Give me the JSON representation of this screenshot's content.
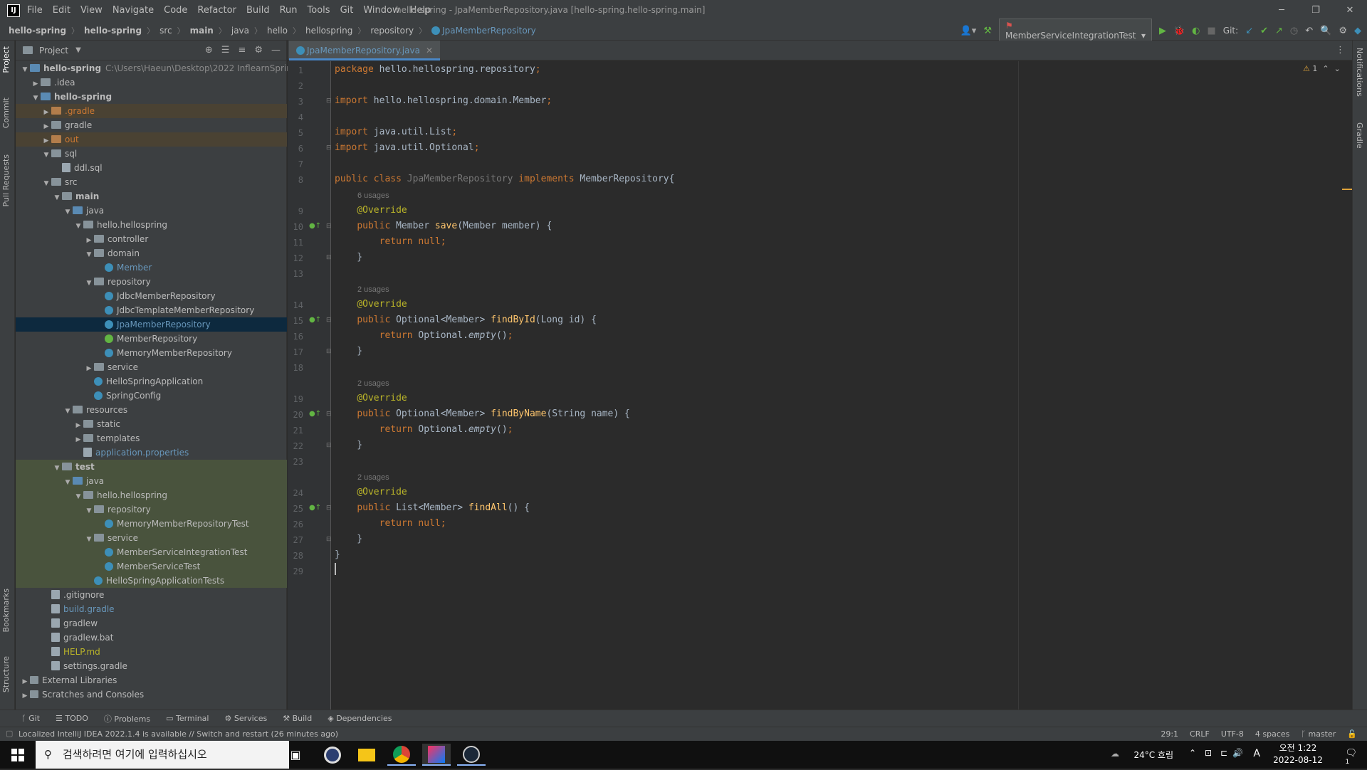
{
  "window": {
    "title": "hello-spring - JpaMemberRepository.java [hello-spring.hello-spring.main]",
    "menu": [
      "File",
      "Edit",
      "View",
      "Navigate",
      "Code",
      "Refactor",
      "Build",
      "Run",
      "Tools",
      "Git",
      "Window",
      "Help"
    ]
  },
  "breadcrumb": [
    "hello-spring",
    "hello-spring",
    "src",
    "main",
    "java",
    "hello",
    "hellospring",
    "repository",
    "JpaMemberRepository"
  ],
  "toolbar": {
    "run_config": "MemberServiceIntegrationTest",
    "git_label": "Git:"
  },
  "project": {
    "title": "Project",
    "tree": [
      {
        "label": "hello-spring",
        "extra": "C:\\Users\\Haeun\\Desktop\\2022 InflearnSpring",
        "depth": 0,
        "kind": "folder-blue",
        "arrow": "open",
        "bold": true
      },
      {
        "label": ".idea",
        "depth": 1,
        "kind": "folder",
        "arrow": "closed"
      },
      {
        "label": "hello-spring",
        "depth": 1,
        "kind": "folder-blue",
        "arrow": "open",
        "bold": true
      },
      {
        "label": ".gradle",
        "depth": 2,
        "kind": "folder-orange",
        "arrow": "closed",
        "color": "orange",
        "hl": "orange"
      },
      {
        "label": "gradle",
        "depth": 2,
        "kind": "folder",
        "arrow": "closed"
      },
      {
        "label": "out",
        "depth": 2,
        "kind": "folder-orange",
        "arrow": "closed",
        "color": "orange",
        "hl": "orange"
      },
      {
        "label": "sql",
        "depth": 2,
        "kind": "folder",
        "arrow": "open"
      },
      {
        "label": "ddl.sql",
        "depth": 3,
        "kind": "file"
      },
      {
        "label": "src",
        "depth": 2,
        "kind": "folder",
        "arrow": "open"
      },
      {
        "label": "main",
        "depth": 3,
        "kind": "folder",
        "arrow": "open",
        "bold": true
      },
      {
        "label": "java",
        "depth": 4,
        "kind": "folder-blue",
        "arrow": "open"
      },
      {
        "label": "hello.hellospring",
        "depth": 5,
        "kind": "folder",
        "arrow": "open"
      },
      {
        "label": "controller",
        "depth": 6,
        "kind": "folder",
        "arrow": "closed"
      },
      {
        "label": "domain",
        "depth": 6,
        "kind": "folder",
        "arrow": "open"
      },
      {
        "label": "Member",
        "depth": 7,
        "kind": "class",
        "color": "blue"
      },
      {
        "label": "repository",
        "depth": 6,
        "kind": "folder",
        "arrow": "open"
      },
      {
        "label": "JdbcMemberRepository",
        "depth": 7,
        "kind": "class"
      },
      {
        "label": "JdbcTemplateMemberRepository",
        "depth": 7,
        "kind": "class"
      },
      {
        "label": "JpaMemberRepository",
        "depth": 7,
        "kind": "class",
        "color": "blue",
        "hl": "sel"
      },
      {
        "label": "MemberRepository",
        "depth": 7,
        "kind": "interface"
      },
      {
        "label": "MemoryMemberRepository",
        "depth": 7,
        "kind": "class"
      },
      {
        "label": "service",
        "depth": 6,
        "kind": "folder",
        "arrow": "closed"
      },
      {
        "label": "HelloSpringApplication",
        "depth": 6,
        "kind": "class"
      },
      {
        "label": "SpringConfig",
        "depth": 6,
        "kind": "class"
      },
      {
        "label": "resources",
        "depth": 4,
        "kind": "folder",
        "arrow": "open"
      },
      {
        "label": "static",
        "depth": 5,
        "kind": "folder",
        "arrow": "closed"
      },
      {
        "label": "templates",
        "depth": 5,
        "kind": "folder",
        "arrow": "closed"
      },
      {
        "label": "application.properties",
        "depth": 5,
        "kind": "file",
        "color": "blue"
      },
      {
        "label": "test",
        "depth": 3,
        "kind": "folder",
        "arrow": "open",
        "bold": true,
        "hl": "green"
      },
      {
        "label": "java",
        "depth": 4,
        "kind": "folder-blue",
        "arrow": "open",
        "hl": "green"
      },
      {
        "label": "hello.hellospring",
        "depth": 5,
        "kind": "folder",
        "arrow": "open",
        "hl": "green"
      },
      {
        "label": "repository",
        "depth": 6,
        "kind": "folder",
        "arrow": "open",
        "hl": "green"
      },
      {
        "label": "MemoryMemberRepositoryTest",
        "depth": 7,
        "kind": "class",
        "hl": "green"
      },
      {
        "label": "service",
        "depth": 6,
        "kind": "folder",
        "arrow": "open",
        "hl": "green"
      },
      {
        "label": "MemberServiceIntegrationTest",
        "depth": 7,
        "kind": "class",
        "hl": "green"
      },
      {
        "label": "MemberServiceTest",
        "depth": 7,
        "kind": "class",
        "hl": "green"
      },
      {
        "label": "HelloSpringApplicationTests",
        "depth": 6,
        "kind": "class",
        "hl": "green"
      },
      {
        "label": ".gitignore",
        "depth": 2,
        "kind": "file"
      },
      {
        "label": "build.gradle",
        "depth": 2,
        "kind": "file",
        "color": "blue"
      },
      {
        "label": "gradlew",
        "depth": 2,
        "kind": "file"
      },
      {
        "label": "gradlew.bat",
        "depth": 2,
        "kind": "file"
      },
      {
        "label": "HELP.md",
        "depth": 2,
        "kind": "file",
        "color": "gold"
      },
      {
        "label": "settings.gradle",
        "depth": 2,
        "kind": "file"
      },
      {
        "label": "External Libraries",
        "depth": 0,
        "kind": "lib",
        "arrow": "closed"
      },
      {
        "label": "Scratches and Consoles",
        "depth": 0,
        "kind": "lib",
        "arrow": "closed"
      }
    ]
  },
  "editor": {
    "tab": "JpaMemberRepository.java",
    "warnings": "1",
    "lines": [
      {
        "n": "1",
        "html": "<span class='kw'>package</span> hello.hellospring.repository<span class='kw'>;</span>"
      },
      {
        "n": "2",
        "html": ""
      },
      {
        "n": "3",
        "html": "<span class='kw'>import</span> hello.hellospring.domain.Member<span class='kw'>;</span>",
        "fold": true
      },
      {
        "n": "4",
        "html": ""
      },
      {
        "n": "5",
        "html": "<span class='kw'>import</span> java.util.List<span class='kw'>;</span>"
      },
      {
        "n": "6",
        "html": "<span class='kw'>import</span> java.util.Optional<span class='kw'>;</span>",
        "fold": true
      },
      {
        "n": "7",
        "html": ""
      },
      {
        "n": "8",
        "html": "<span class='kw'>public class</span> <span class='un'>JpaMemberRepository</span> <span class='kw'>implements</span> MemberRepository{"
      },
      {
        "hint": "6 usages"
      },
      {
        "n": "9",
        "html": "    <span class='ann'>@Override</span>"
      },
      {
        "n": "10",
        "html": "    <span class='kw'>public</span> Member <span class='fn'>save</span>(Member member) {",
        "gm": true,
        "fold": true
      },
      {
        "n": "11",
        "html": "        <span class='kw'>return null;</span>"
      },
      {
        "n": "12",
        "html": "    }",
        "fold": true
      },
      {
        "n": "13",
        "html": ""
      },
      {
        "hint": "2 usages"
      },
      {
        "n": "14",
        "html": "    <span class='ann'>@Override</span>"
      },
      {
        "n": "15",
        "html": "    <span class='kw'>public</span> Optional&lt;Member&gt; <span class='fn'>findById</span>(Long id) {",
        "gm": true,
        "fold": true
      },
      {
        "n": "16",
        "html": "        <span class='kw'>return</span> Optional.<span class='it'>empty</span>()<span class='kw'>;</span>"
      },
      {
        "n": "17",
        "html": "    }",
        "fold": true
      },
      {
        "n": "18",
        "html": ""
      },
      {
        "hint": "2 usages"
      },
      {
        "n": "19",
        "html": "    <span class='ann'>@Override</span>"
      },
      {
        "n": "20",
        "html": "    <span class='kw'>public</span> Optional&lt;Member&gt; <span class='fn'>findByName</span>(String name) {",
        "gm": true,
        "fold": true
      },
      {
        "n": "21",
        "html": "        <span class='kw'>return</span> Optional.<span class='it'>empty</span>()<span class='kw'>;</span>"
      },
      {
        "n": "22",
        "html": "    }",
        "fold": true
      },
      {
        "n": "23",
        "html": ""
      },
      {
        "hint": "2 usages"
      },
      {
        "n": "24",
        "html": "    <span class='ann'>@Override</span>"
      },
      {
        "n": "25",
        "html": "    <span class='kw'>public</span> List&lt;Member&gt; <span class='fn'>findAll</span>() {",
        "gm": true,
        "fold": true
      },
      {
        "n": "26",
        "html": "        <span class='kw'>return null;</span>"
      },
      {
        "n": "27",
        "html": "    }",
        "fold": true
      },
      {
        "n": "28",
        "html": "}"
      },
      {
        "n": "29",
        "html": ""
      }
    ]
  },
  "side_tools": {
    "left_top": [
      "Project",
      "Commit",
      "Pull Requests"
    ],
    "left_bottom": [
      "Bookmarks",
      "Structure"
    ],
    "right": [
      "Notifications",
      "Gradle"
    ]
  },
  "bottom_tools": [
    "Git",
    "TODO",
    "Problems",
    "Terminal",
    "Services",
    "Build",
    "Dependencies"
  ],
  "status": {
    "message": "Localized IntelliJ IDEA 2022.1.4 is available // Switch and restart (26 minutes ago)",
    "position": "29:1",
    "line_sep": "CRLF",
    "encoding": "UTF-8",
    "indent": "4 spaces",
    "branch": "master"
  },
  "taskbar": {
    "search_placeholder": "검색하려면 여기에 입력하십시오",
    "weather": "24°C 흐림",
    "ime": "A",
    "time": "오전 1:22",
    "date": "2022-08-12",
    "notif_count": "1"
  }
}
